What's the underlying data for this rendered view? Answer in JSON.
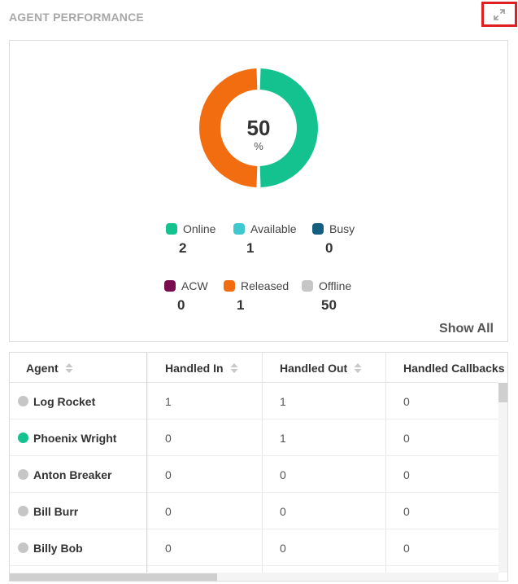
{
  "widget": {
    "title": "AGENT PERFORMANCE",
    "expand_icon": "expand-arrows-icon",
    "highlight_color": "#e02020"
  },
  "donut": {
    "center_value": "50",
    "center_unit": "%",
    "segments": [
      {
        "name": "Online",
        "fraction": 0.5,
        "color": "#14c28f"
      },
      {
        "name": "Released",
        "fraction": 0.5,
        "color": "#f26d0f"
      }
    ]
  },
  "legend": [
    {
      "label": "Online",
      "count": "2",
      "color": "#14c28f"
    },
    {
      "label": "Available",
      "count": "1",
      "color": "#3fc9cf"
    },
    {
      "label": "Busy",
      "count": "0",
      "color": "#155e80"
    },
    {
      "label": "ACW",
      "count": "0",
      "color": "#7a0b4f"
    },
    {
      "label": "Released",
      "count": "1",
      "color": "#f26d0f"
    },
    {
      "label": "Offline",
      "count": "50",
      "color": "#c6c6c6"
    }
  ],
  "show_all_label": "Show All",
  "table": {
    "columns": [
      "Agent",
      "Handled In",
      "Handled Out",
      "Handled Callbacks"
    ],
    "rows": [
      {
        "agent": "Log Rocket",
        "status_color": "#c6c6c6",
        "handled_in": "1",
        "handled_out": "1",
        "handled_callbacks": "0"
      },
      {
        "agent": "Phoenix Wright",
        "status_color": "#14c28f",
        "handled_in": "0",
        "handled_out": "1",
        "handled_callbacks": "0"
      },
      {
        "agent": "Anton Breaker",
        "status_color": "#c6c6c6",
        "handled_in": "0",
        "handled_out": "0",
        "handled_callbacks": "0"
      },
      {
        "agent": "Bill Burr",
        "status_color": "#c6c6c6",
        "handled_in": "0",
        "handled_out": "0",
        "handled_callbacks": "0"
      },
      {
        "agent": "Billy Bob",
        "status_color": "#c6c6c6",
        "handled_in": "0",
        "handled_out": "0",
        "handled_callbacks": "0"
      }
    ]
  }
}
